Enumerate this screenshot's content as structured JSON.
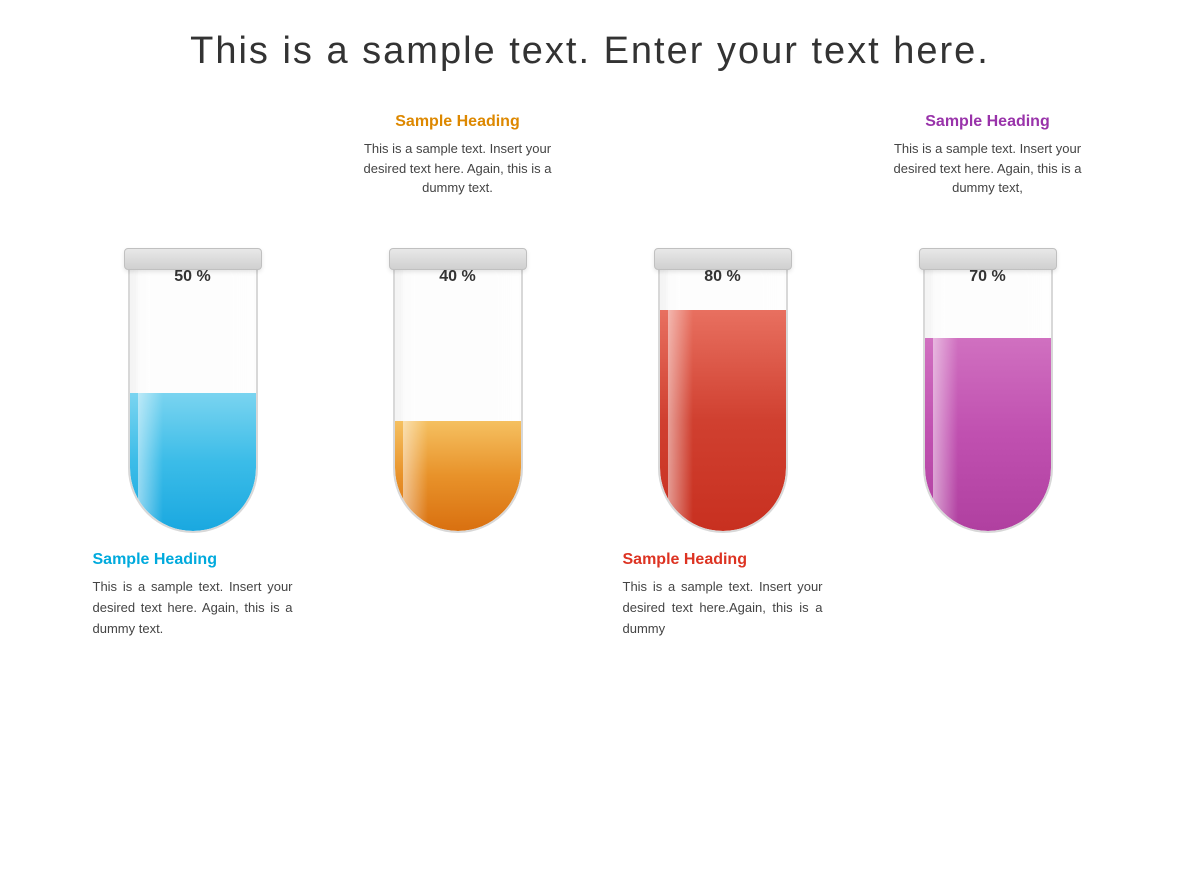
{
  "title": "This is a sample text. Enter your text here.",
  "tubes": [
    {
      "id": "blue",
      "percentage": "50 %",
      "fill_height_pct": 50,
      "color_class": "tube-blue",
      "heading_position": "bottom",
      "heading": "Sample Heading",
      "heading_color": "color-blue",
      "body": "This is a sample text. Insert your desired text here. Again, this is a dummy text."
    },
    {
      "id": "orange",
      "percentage": "40 %",
      "fill_height_pct": 40,
      "color_class": "tube-orange",
      "heading_position": "top",
      "heading": "Sample Heading",
      "heading_color": "color-orange",
      "body": "This is a sample text. Insert your desired text here. Again, this is a dummy text."
    },
    {
      "id": "red",
      "percentage": "80 %",
      "fill_height_pct": 80,
      "color_class": "tube-red",
      "heading_position": "bottom",
      "heading": "Sample Heading",
      "heading_color": "color-red",
      "body": "This is a sample text. Insert your desired text here.Again, this is a dummy"
    },
    {
      "id": "purple",
      "percentage": "70 %",
      "fill_height_pct": 70,
      "color_class": "tube-purple",
      "heading_position": "top",
      "heading": "Sample Heading",
      "heading_color": "color-purple",
      "body": "This is a sample text. Insert your desired text here. Again, this is a dummy text,"
    }
  ]
}
